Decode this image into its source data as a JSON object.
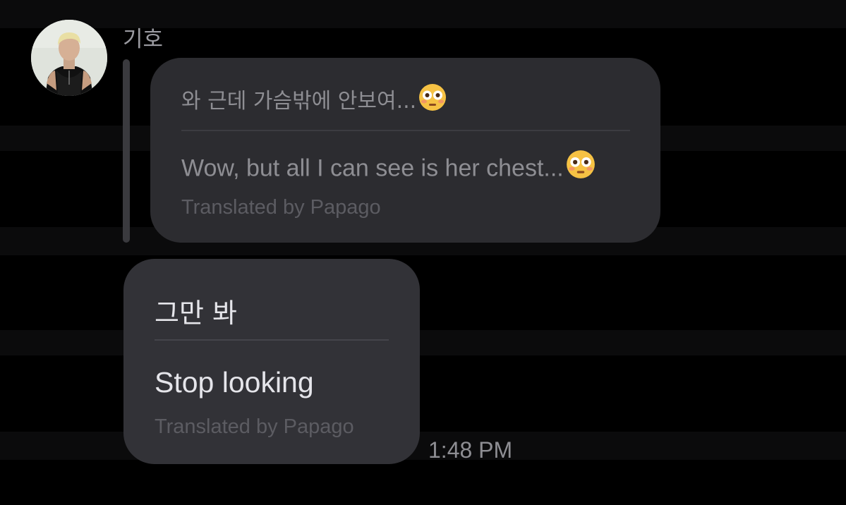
{
  "conversation": {
    "sender_name": "기호",
    "avatar_icon": "profile-photo",
    "quoted_message": {
      "original": "와 근데 가슴밖에 안보여...",
      "translation": "Wow, but all I can see is her chest...",
      "emoji_icon": "flushed-face-emoji",
      "credit": "Translated by Papago"
    },
    "message": {
      "original": "그만 봐",
      "translation": "Stop looking",
      "credit": "Translated by Papago"
    },
    "timestamp": "1:48 PM"
  },
  "colors": {
    "background": "#000000",
    "bubble": "#2c2c30",
    "text_primary": "#e5e5ea",
    "text_secondary": "#8e8e93",
    "text_muted": "#5c5c62",
    "emoji_face": "#f6c244"
  }
}
